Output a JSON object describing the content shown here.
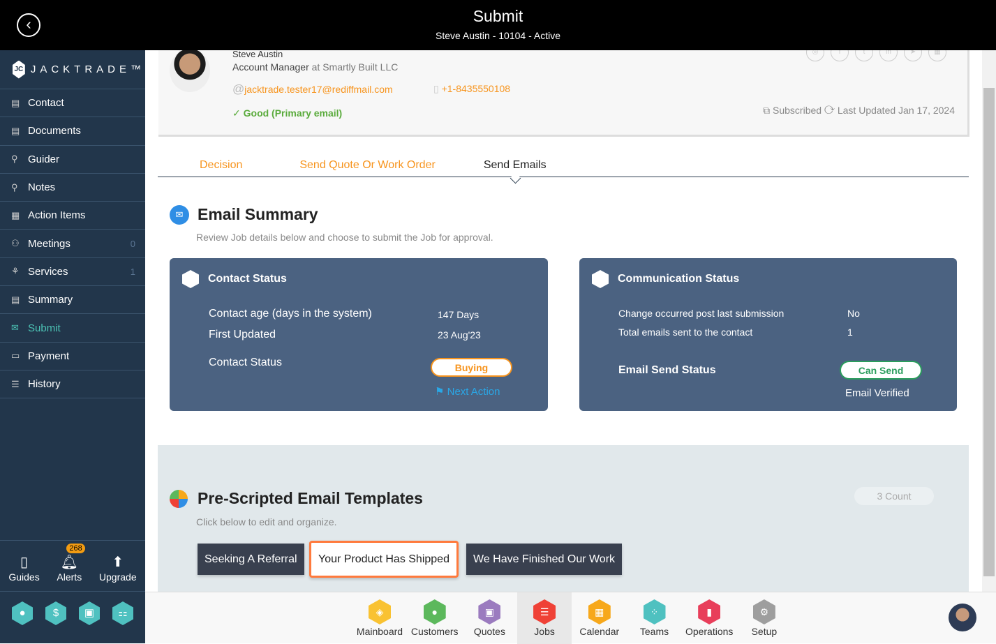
{
  "header": {
    "title": "Submit",
    "subtitle": "Steve Austin - 10104 - Active"
  },
  "sidebar": {
    "logo": "JACKTRADE™",
    "items": [
      {
        "label": "Contact",
        "icon": "contact-book-icon"
      },
      {
        "label": "Documents",
        "icon": "document-icon"
      },
      {
        "label": "Guider",
        "icon": "signpost-icon"
      },
      {
        "label": "Notes",
        "icon": "signpost-icon"
      },
      {
        "label": "Action Items",
        "icon": "clipboard-icon"
      },
      {
        "label": "Meetings",
        "icon": "meeting-icon",
        "count": "0"
      },
      {
        "label": "Services",
        "icon": "services-icon",
        "count": "1"
      },
      {
        "label": "Summary",
        "icon": "summary-icon"
      },
      {
        "label": "Submit",
        "icon": "submit-mail-icon",
        "active": true
      },
      {
        "label": "Payment",
        "icon": "payment-icon"
      },
      {
        "label": "History",
        "icon": "history-icon"
      }
    ],
    "bottom": {
      "guides": "Guides",
      "alerts": "Alerts",
      "alerts_count": "268",
      "upgrade": "Upgrade"
    }
  },
  "profile": {
    "name": "Steve Austin",
    "role": "Account Manager",
    "at": "at Smartly Built LLC",
    "email": "jacktrade.tester17@rediffmail.com",
    "phone": "+1-8435550108",
    "email_status": "Good (Primary email)",
    "subscribed": "Subscribed",
    "last_updated": "Last Updated Jan 17, 2024"
  },
  "tabs": [
    "Decision",
    "Send Quote Or Work Order",
    "Send Emails"
  ],
  "email_summary": {
    "title": "Email Summary",
    "desc": "Review Job details below and choose to submit the Job for approval."
  },
  "contact_status": {
    "title": "Contact Status",
    "age_label": "Contact age (days in the system)",
    "age": "147 Days",
    "first_label": "First Updated",
    "first": "23 Aug'23",
    "status_label": "Contact Status",
    "status": "Buying",
    "next_action": "Next Action"
  },
  "communication_status": {
    "title": "Communication Status",
    "change_label": "Change occurred post last submission",
    "change": "No",
    "total_label": "Total emails sent to the contact",
    "total": "1",
    "send_label": "Email Send Status",
    "send": "Can Send",
    "verified": "Email Verified"
  },
  "templates": {
    "title": "Pre-Scripted Email Templates",
    "desc": "Click below to edit and organize.",
    "count": "3 Count",
    "items": [
      "Seeking A Referral",
      "Your Product Has Shipped",
      "We Have Finished Our Work"
    ]
  },
  "apps": [
    {
      "label": "Mainboard",
      "color": "#f9c232"
    },
    {
      "label": "Customers",
      "color": "#5cb85c"
    },
    {
      "label": "Quotes",
      "color": "#9b7bbf"
    },
    {
      "label": "Jobs",
      "color": "#ef4136",
      "active": true
    },
    {
      "label": "Calendar",
      "color": "#f7a81b"
    },
    {
      "label": "Teams",
      "color": "#4fc1c0"
    },
    {
      "label": "Operations",
      "color": "#e83e5a"
    },
    {
      "label": "Setup",
      "color": "#9e9e9e"
    }
  ],
  "colors": {
    "sidebar": "#22364b",
    "accent": "#f7941d",
    "card": "#4b6281",
    "active_nav": "#4cc3b5"
  }
}
